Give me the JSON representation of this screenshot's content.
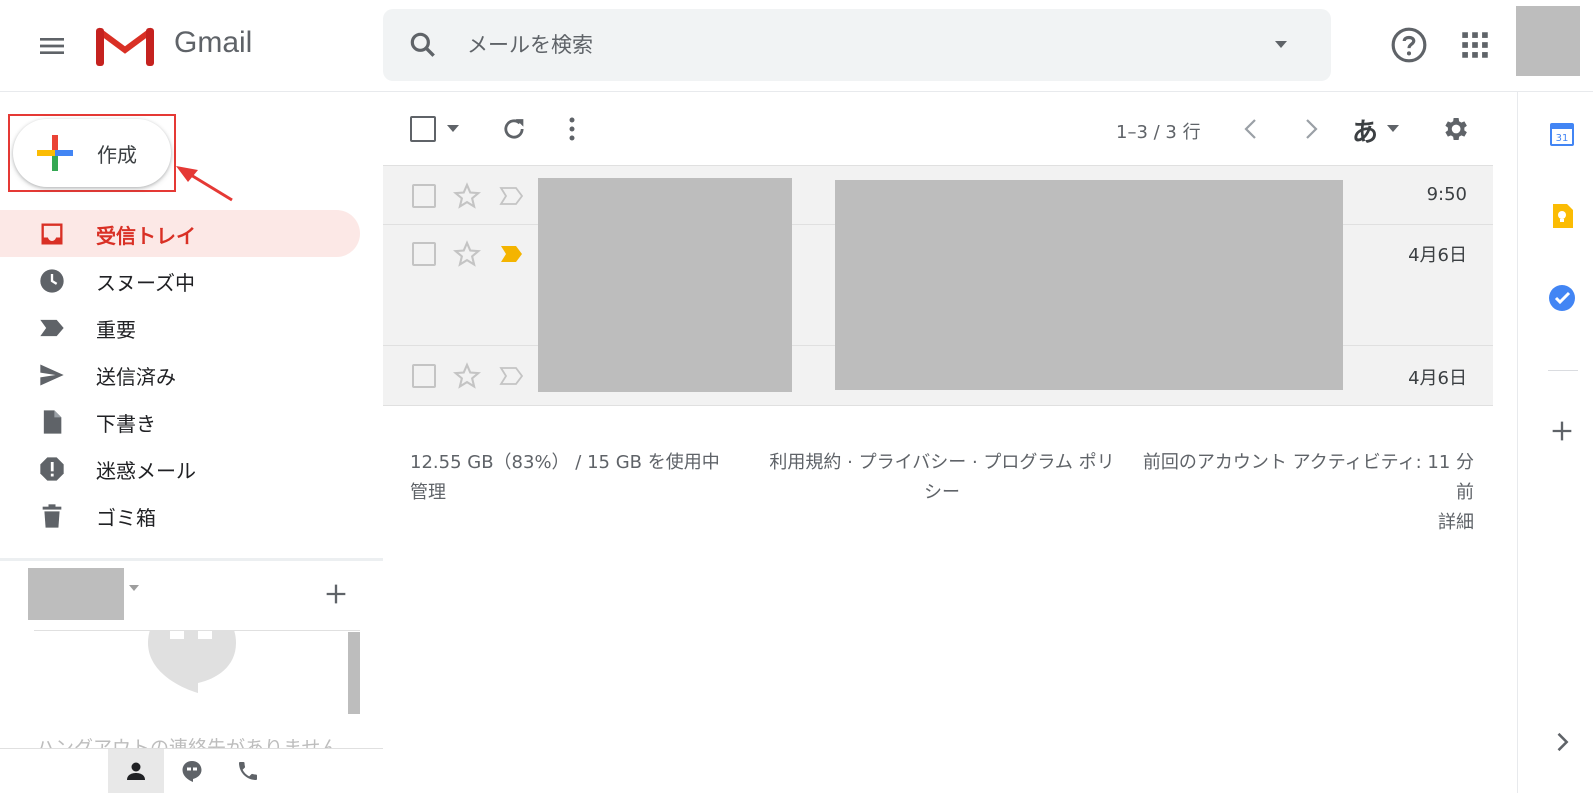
{
  "header": {
    "logo_text": "Gmail",
    "search_placeholder": "メールを検索"
  },
  "compose": {
    "label": "作成"
  },
  "nav": [
    {
      "label": "受信トレイ",
      "icon": "inbox-icon",
      "active": true
    },
    {
      "label": "スヌーズ中",
      "icon": "clock-icon"
    },
    {
      "label": "重要",
      "icon": "important-icon"
    },
    {
      "label": "送信済み",
      "icon": "send-icon"
    },
    {
      "label": "下書き",
      "icon": "draft-icon"
    },
    {
      "label": "迷惑メール",
      "icon": "spam-icon"
    },
    {
      "label": "ゴミ箱",
      "icon": "trash-icon"
    }
  ],
  "chat": {
    "empty_text": "ハングアウトの連絡先がありません"
  },
  "toolbar": {
    "range": "1–3 / 3 行",
    "input_mode": "あ"
  },
  "messages": [
    {
      "date": "9:50",
      "important": false
    },
    {
      "date": "4月6日",
      "important": true
    },
    {
      "date": "4月6日",
      "important": false
    }
  ],
  "footer": {
    "storage": "12.55 GB（83%） / 15 GB を使用中",
    "manage": "管理",
    "terms": "利用規約 · プライバシー · プログラム ポリシー",
    "activity": "前回のアカウント アクティビティ: 11 分前",
    "details": "詳細"
  },
  "colors": {
    "accent_red": "#d93025",
    "active_nav_bg": "#fce8e6",
    "important_yellow": "#f4b400",
    "annotation_red": "#e53935"
  }
}
